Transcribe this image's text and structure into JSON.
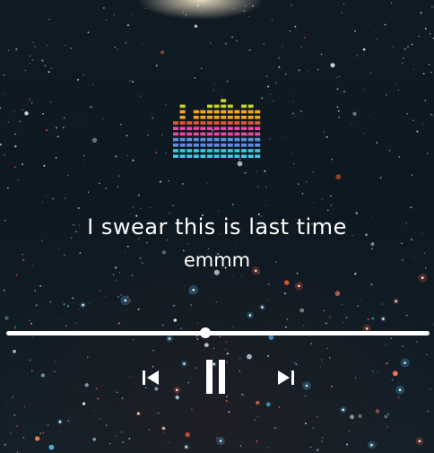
{
  "song": {
    "title": "I swear this is last time",
    "artist": "emmm"
  },
  "playback": {
    "state": "playing",
    "progress_fraction": 0.47
  },
  "controls": {
    "prev_icon": "skip-previous-icon",
    "pause_icon": "pause-icon",
    "next_icon": "skip-next-icon"
  },
  "colors": {
    "text": "#ffffff",
    "eq_rows": [
      "#3ec8e6",
      "#5b8fe6",
      "#e84aa4",
      "#e8572e",
      "#f4a61e",
      "#c6d42a",
      "#43c94a"
    ]
  }
}
